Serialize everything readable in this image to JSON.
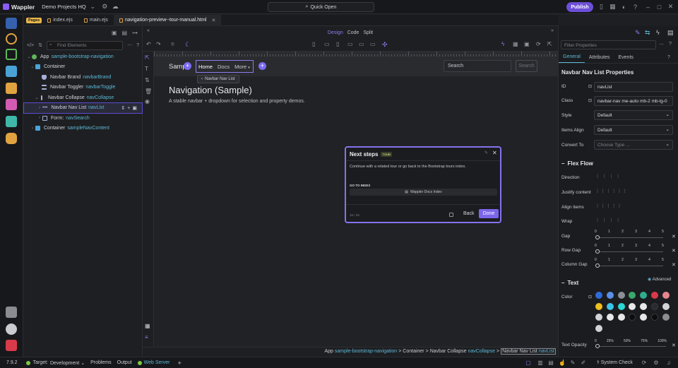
{
  "app": {
    "name": "Wappler",
    "project": "Demo Projects HQ",
    "quick_open": "Quick Open",
    "publish": "Publish",
    "version": "7.9.2"
  },
  "tabs": {
    "badge": "Pages",
    "files": [
      "index.ejs",
      "main.ejs",
      "navigation-preview--tour-manual.html"
    ]
  },
  "tree": {
    "search_placeholder": "Find Elements",
    "rows": [
      {
        "label": "App",
        "id": "sample-bootstrap-navigation"
      },
      {
        "label": "Container",
        "id": ""
      },
      {
        "label": "Navbar Brand",
        "id": "navbarBrand"
      },
      {
        "label": "Navbar Toggler",
        "id": "navbarToggle"
      },
      {
        "label": "Navbar Collapse",
        "id": "navCollapse"
      },
      {
        "label": "Navbar Nav List",
        "id": "navList"
      },
      {
        "label": "Form:",
        "id": "navSearch"
      },
      {
        "label": "Container",
        "id": "sampleNavContent"
      }
    ]
  },
  "view": {
    "design": "Design",
    "code": "Code",
    "split": "Split"
  },
  "page": {
    "brand": "Samp",
    "nav": [
      "Home",
      "Docs",
      "More"
    ],
    "search_placeholder": "Search",
    "search_button": "Search",
    "tooltip": "Navbar Nav List",
    "heading": "Navigation (Sample)",
    "lead": "A stable navbar + dropdown for selection and property demos."
  },
  "tour": {
    "title": "Next steps",
    "badge": "TOUR",
    "text": "Continue with a related tour or go back to the Bootstrap tours index.",
    "goto": "GO TO INDEX",
    "docs": "Wappler Docs Index",
    "step": "16 / 16",
    "back": "Back",
    "done": "Done"
  },
  "breadcrumb": {
    "app": "App",
    "app_id": "sample-bootstrap-navigation",
    "c1": "Container",
    "c2": "Navbar Collapse",
    "c2_id": "navCollapse",
    "c3": "Navbar Nav List",
    "c3_id": "navList",
    "sep": ">"
  },
  "props": {
    "filter_placeholder": "Filter Properties",
    "tabs": [
      "General",
      "Attributes",
      "Events"
    ],
    "title": "Navbar Nav List Properties",
    "id_label": "ID",
    "id_value": "navList",
    "class_label": "Class",
    "class_value": "navbar-nav me-auto mb-2 mb-lg-0",
    "style_label": "Style",
    "style_value": "Default",
    "items_align_label": "Items Align",
    "items_align_value": "Default",
    "convert_label": "Convert To",
    "convert_placeholder": "Choose Type ...",
    "flex_section": "Flex Flow",
    "direction": "Direction",
    "justify": "Justify content",
    "align_items": "Align items",
    "wrap": "Wrap",
    "gap": "Gap",
    "row_gap": "Row Gap",
    "col_gap": "Column Gap",
    "slider_ticks": [
      "0",
      "1",
      "2",
      "3",
      "4",
      "5"
    ],
    "text_section": "Text",
    "advanced": "Advanced",
    "color": "Color",
    "text_opacity": "Text Opacity",
    "opacity_ticks": [
      "0",
      "25%",
      "50%",
      "75%",
      "100%"
    ]
  },
  "status": {
    "target_label": "Target:",
    "target": "Development",
    "problems": "Problems",
    "output": "Output",
    "web_server": "Web Server",
    "system_check": "System Check"
  },
  "colors": {
    "accent": "#6d4fd8",
    "swatches": [
      "#2f6bd8",
      "#5a8fe8",
      "#8b8d93",
      "#39a96b",
      "#2fae8c",
      "#d83a4a",
      "#e8848e",
      "#f0c020",
      "#3bc3e8",
      "#2bd6d6",
      "#e8e8ea",
      "#e8e8ea",
      "#2a2b2f",
      "#d2d3d6",
      "#d2d3d6",
      "#e8e8ea",
      "#e8e8ea",
      "#0c0c0e",
      "#e8e8ea",
      "#0c0c0e",
      "#8b8d93",
      "#d2d3d6"
    ]
  }
}
